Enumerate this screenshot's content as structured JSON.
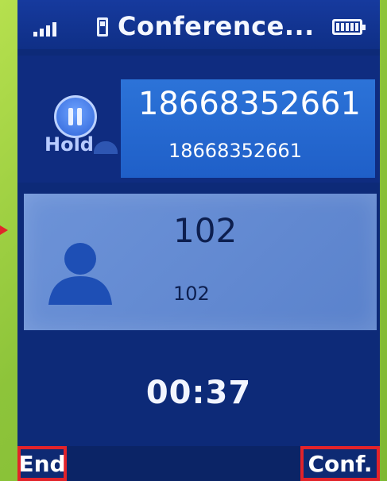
{
  "status_bar": {
    "title": "Conference..."
  },
  "held_call": {
    "hold_label": "Hold",
    "number_primary": "18668352661",
    "number_secondary": "18668352661"
  },
  "active_call": {
    "name_primary": "102",
    "name_secondary": "102"
  },
  "timer": "00:37",
  "softkeys": {
    "left": "End",
    "right": "Conf."
  },
  "colors": {
    "screen_bg": "#0d2a78",
    "highlight_box": "#2468d0",
    "active_card": "#6a90d6",
    "annotation_red": "#e2232a"
  }
}
